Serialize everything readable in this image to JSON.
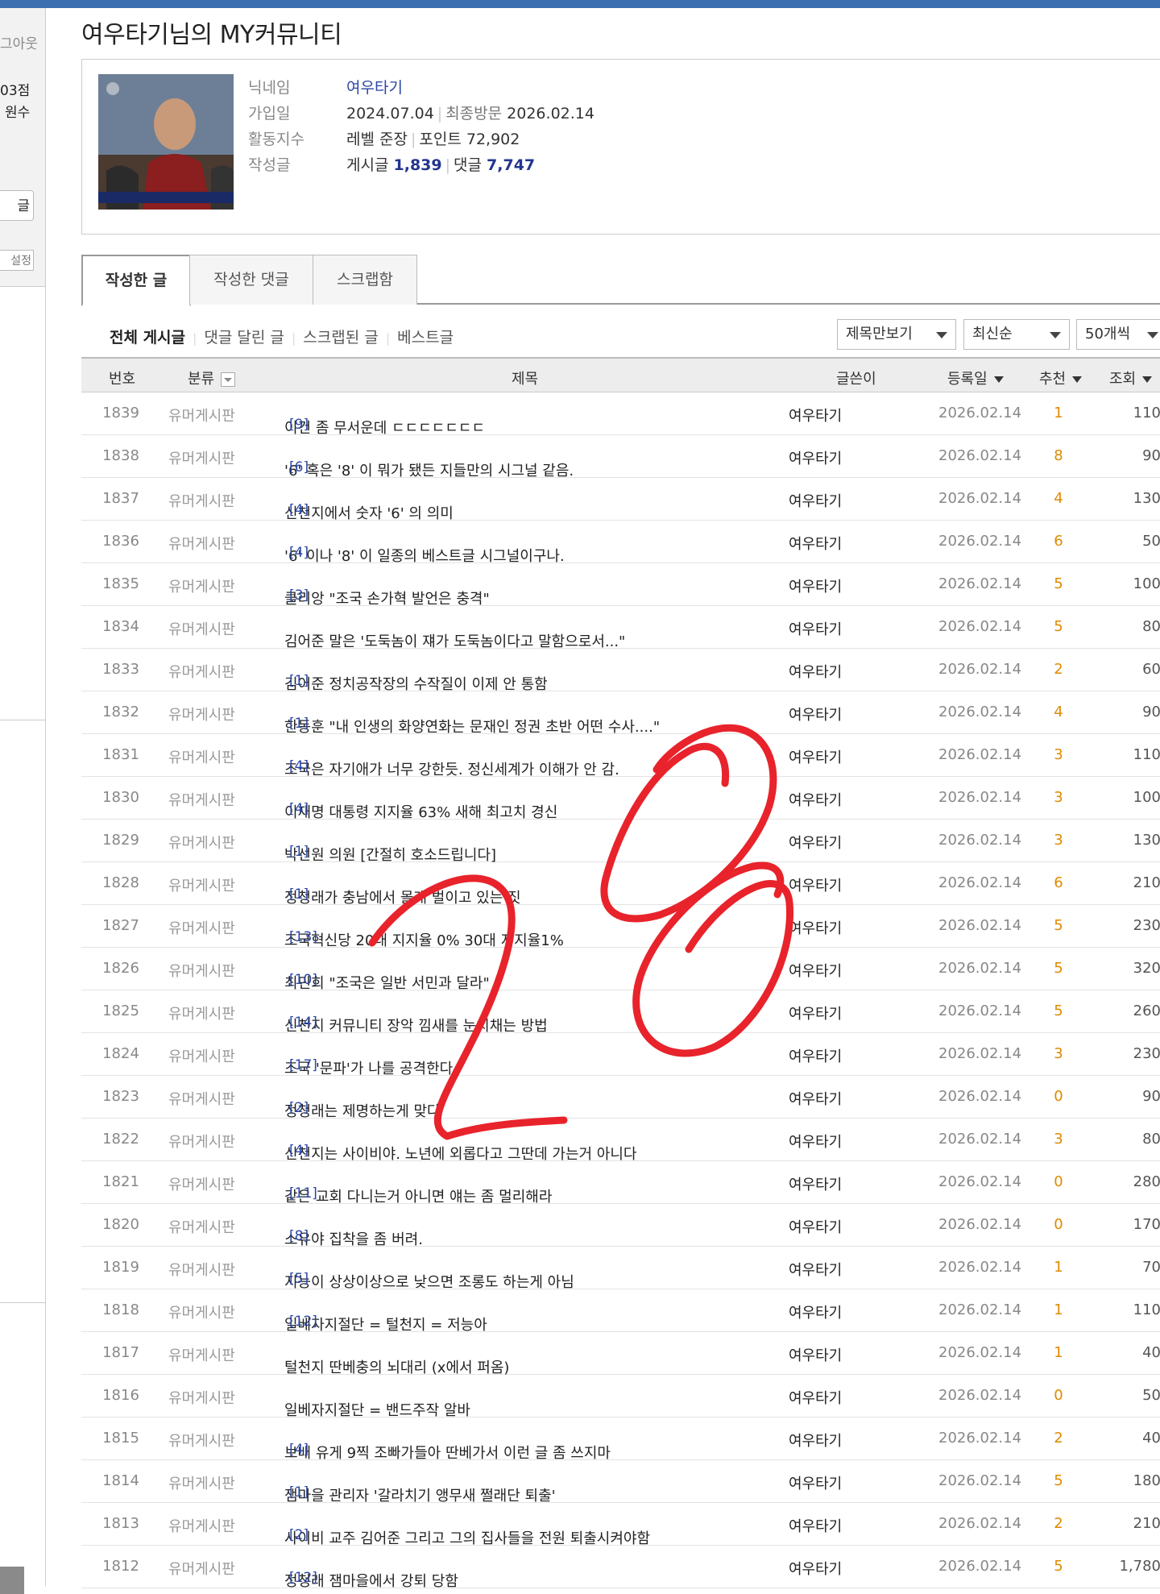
{
  "sidebar": {
    "logout": "그아웃",
    "points": "03점",
    "rank": "원수",
    "button_label": "글",
    "settings_label": "설정"
  },
  "page_title": "여우타기님의 MY커뮤니티",
  "profile": {
    "nickname_label": "닉네임",
    "nickname": "여우타기",
    "joined_label": "가입일",
    "joined": "2024.07.04",
    "last_visit_label": "최종방문",
    "last_visit": "2026.02.14",
    "activity_label": "활동지수",
    "level": "레벨 준장",
    "points": "포인트 72,902",
    "posts_label": "작성글",
    "posts_title": "게시글",
    "posts_count": "1,839",
    "comments_title": "댓글",
    "comments_count": "7,747"
  },
  "tabs": [
    "작성한 글",
    "작성한 댓글",
    "스크랩함"
  ],
  "filters": [
    "전체 게시글",
    "댓글 달린 글",
    "스크랩된 글",
    "베스트글"
  ],
  "dropdowns": {
    "view_mode": "제목만보기",
    "sort": "최신순",
    "per_page": "50개씩"
  },
  "table_headers": {
    "no": "번호",
    "category": "분류",
    "title": "제목",
    "author": "글쓴이",
    "date": "등록일",
    "recommend": "추천",
    "views": "조회"
  },
  "posts": [
    {
      "no": "1839",
      "category": "유머게시판",
      "title": "이건 좀 무서운데 ㄷㄷㄷㄷㄷㄷㄷ",
      "comments": "[9]",
      "author": "여우타기",
      "date": "2026.02.14",
      "rec": "1",
      "views": "110"
    },
    {
      "no": "1838",
      "category": "유머게시판",
      "title": "'6' 혹은 '8' 이 뭐가 됐든 지들만의 시그널 같음.",
      "comments": "[6]",
      "author": "여우타기",
      "date": "2026.02.14",
      "rec": "8",
      "views": "90"
    },
    {
      "no": "1837",
      "category": "유머게시판",
      "title": "신천지에서 숫자 '6' 의 의미",
      "comments": "[4]",
      "author": "여우타기",
      "date": "2026.02.14",
      "rec": "4",
      "views": "130"
    },
    {
      "no": "1836",
      "category": "유머게시판",
      "title": "'6' 이나 '8' 이 일종의 베스트글 시그널이구나.",
      "comments": "[4]",
      "author": "여우타기",
      "date": "2026.02.14",
      "rec": "6",
      "views": "50"
    },
    {
      "no": "1835",
      "category": "유머게시판",
      "title": "클리앙 \"조국 손가혁 발언은 충격\"",
      "comments": "[3]",
      "author": "여우타기",
      "date": "2026.02.14",
      "rec": "5",
      "views": "100"
    },
    {
      "no": "1834",
      "category": "유머게시판",
      "title": "김어준 말은 '도둑놈이 쟤가 도둑놈이다고 말함으로서...\"",
      "comments": "",
      "author": "여우타기",
      "date": "2026.02.14",
      "rec": "5",
      "views": "80"
    },
    {
      "no": "1833",
      "category": "유머게시판",
      "title": "김어준 정치공작장의 수작질이 이제 안 통함",
      "comments": "[1]",
      "author": "여우타기",
      "date": "2026.02.14",
      "rec": "2",
      "views": "60"
    },
    {
      "no": "1832",
      "category": "유머게시판",
      "title": "한동훈 \"내 인생의 화양연화는 문재인 정권 초반 어떤 수사....\"",
      "comments": "[1]",
      "author": "여우타기",
      "date": "2026.02.14",
      "rec": "4",
      "views": "90"
    },
    {
      "no": "1831",
      "category": "유머게시판",
      "title": "조국은 자기애가 너무 강한듯. 정신세계가 이해가 안 감.",
      "comments": "[4]",
      "author": "여우타기",
      "date": "2026.02.14",
      "rec": "3",
      "views": "110"
    },
    {
      "no": "1830",
      "category": "유머게시판",
      "title": "이재명 대통령 지지율 63% 새해 최고치 경신",
      "comments": "[4]",
      "author": "여우타기",
      "date": "2026.02.14",
      "rec": "3",
      "views": "100"
    },
    {
      "no": "1829",
      "category": "유머게시판",
      "title": "박선원 의원 [간절히 호소드립니다]",
      "comments": "[1]",
      "author": "여우타기",
      "date": "2026.02.14",
      "rec": "3",
      "views": "130"
    },
    {
      "no": "1828",
      "category": "유머게시판",
      "title": "정청래가 충남에서 몰래 벌이고 있는 짓",
      "comments": "[1]",
      "author": "여우타기",
      "date": "2026.02.14",
      "rec": "6",
      "views": "210"
    },
    {
      "no": "1827",
      "category": "유머게시판",
      "title": "조국혁신당 20대 지지율 0% 30대 지지율1%",
      "comments": "[13]",
      "author": "여우타기",
      "date": "2026.02.14",
      "rec": "5",
      "views": "230"
    },
    {
      "no": "1826",
      "category": "유머게시판",
      "title": "최민희 \"조국은 일반 서민과 달라\"",
      "comments": "[10]",
      "author": "여우타기",
      "date": "2026.02.14",
      "rec": "5",
      "views": "320"
    },
    {
      "no": "1825",
      "category": "유머게시판",
      "title": "신천지 커뮤니티 장악 낌새를 눈치채는 방법",
      "comments": "[14]",
      "author": "여우타기",
      "date": "2026.02.14",
      "rec": "5",
      "views": "260"
    },
    {
      "no": "1824",
      "category": "유머게시판",
      "title": "조국 '문파'가 나를 공격한다",
      "comments": "[17]",
      "author": "여우타기",
      "date": "2026.02.14",
      "rec": "3",
      "views": "230"
    },
    {
      "no": "1823",
      "category": "유머게시판",
      "title": "정청래는 제명하는게 맞다",
      "comments": "[2]",
      "author": "여우타기",
      "date": "2026.02.14",
      "rec": "0",
      "views": "90"
    },
    {
      "no": "1822",
      "category": "유머게시판",
      "title": "신천지는 사이비야. 노년에 외롭다고 그딴데 가는거 아니다",
      "comments": "[4]",
      "author": "여우타기",
      "date": "2026.02.14",
      "rec": "3",
      "views": "80"
    },
    {
      "no": "1821",
      "category": "유머게시판",
      "title": "같은 교회 다니는거 아니면 얘는 좀 멀리해라",
      "comments": "[11]",
      "author": "여우타기",
      "date": "2026.02.14",
      "rec": "0",
      "views": "280"
    },
    {
      "no": "1820",
      "category": "유머게시판",
      "title": "소유야 집착을 좀 버려.",
      "comments": "[8]",
      "author": "여우타기",
      "date": "2026.02.14",
      "rec": "0",
      "views": "170"
    },
    {
      "no": "1819",
      "category": "유머게시판",
      "title": "지능이 상상이상으로 낮으면 조롱도 하는게 아님",
      "comments": "[5]",
      "author": "여우타기",
      "date": "2026.02.14",
      "rec": "1",
      "views": "70"
    },
    {
      "no": "1818",
      "category": "유머게시판",
      "title": "일베자지절단 = 털천지 = 저능아",
      "comments": "[12]",
      "author": "여우타기",
      "date": "2026.02.14",
      "rec": "1",
      "views": "110"
    },
    {
      "no": "1817",
      "category": "유머게시판",
      "title": "털천지 딴베충의 뇌대리 (x에서 퍼옴)",
      "comments": "",
      "author": "여우타기",
      "date": "2026.02.14",
      "rec": "1",
      "views": "40"
    },
    {
      "no": "1816",
      "category": "유머게시판",
      "title": "일베자지절단 = 밴드주작 알바",
      "comments": "",
      "author": "여우타기",
      "date": "2026.02.14",
      "rec": "0",
      "views": "50"
    },
    {
      "no": "1815",
      "category": "유머게시판",
      "title": "보배 유게 9찍 조빠가들아 딴베가서 이런 글 좀 쓰지마",
      "comments": "[4]",
      "author": "여우타기",
      "date": "2026.02.14",
      "rec": "2",
      "views": "40"
    },
    {
      "no": "1814",
      "category": "유머게시판",
      "title": "잼마을 관리자 '갈라치기 앵무새 쩔래단 퇴출'",
      "comments": "[1]",
      "author": "여우타기",
      "date": "2026.02.14",
      "rec": "5",
      "views": "180"
    },
    {
      "no": "1813",
      "category": "유머게시판",
      "title": "사이비 교주 김어준 그리고 그의 집사들을 전원 퇴출시켜야함",
      "comments": "[2]",
      "author": "여우타기",
      "date": "2026.02.14",
      "rec": "2",
      "views": "210"
    },
    {
      "no": "1812",
      "category": "유머게시판",
      "title": "정청래 잼마을에서 강퇴 당함",
      "comments": "[12]",
      "author": "여우타기",
      "date": "2026.02.14",
      "rec": "5",
      "views": "1,780"
    }
  ],
  "colors": {
    "accent": "#3b6fb0",
    "link": "#2a46a6",
    "recommend": "#e08a00",
    "annotation": "#e8232b"
  }
}
